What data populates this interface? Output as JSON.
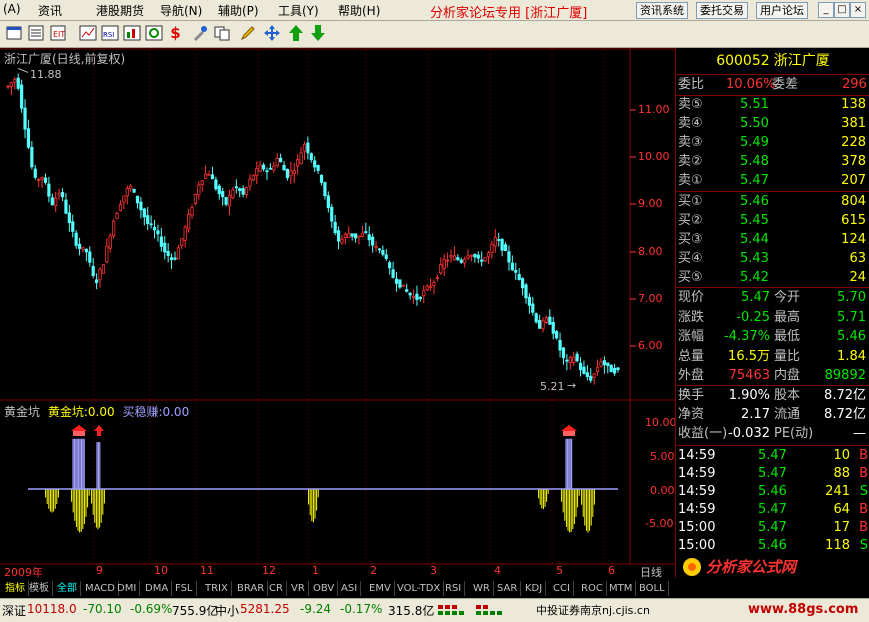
{
  "menubar": {
    "items": [
      "(A)",
      "资讯",
      "港股期货",
      "导航(N)",
      "辅助(P)",
      "工具(Y)",
      "帮助(H)"
    ],
    "notice": "分析家论坛专用 [浙江广厦]",
    "buttons": [
      "资讯系统",
      "委托交易",
      "用户论坛"
    ],
    "window_controls": [
      "_",
      "□",
      "×"
    ]
  },
  "toolbar": {
    "icons": [
      "window-icon",
      "list-icon",
      "edit-icon",
      "line-chart-icon",
      "rsi-icon",
      "chart-grid-icon",
      "refresh-icon",
      "dollar-icon",
      "tool-icon",
      "copy-icon",
      "pencil-icon",
      "move-icon",
      "arrow-up-icon",
      "arrow-down-icon"
    ],
    "labels": [
      "",
      "",
      "",
      "",
      "RSI",
      "",
      "",
      "$",
      "",
      "",
      "",
      "",
      "",
      ""
    ]
  },
  "chart": {
    "title": "浙江广厦(日线,前复权)",
    "high_label": "11.88",
    "low_label": "5.21",
    "price_ticks": [
      "11.00",
      "10.00",
      "9.00",
      "8.00",
      "7.00",
      "6.00"
    ],
    "indicator_title": "黄金坑",
    "indicator_series": [
      {
        "name": "黄金坑:",
        "value": "0.00"
      },
      {
        "name": "买稳赚:",
        "value": "0.00"
      }
    ],
    "indicator_ticks": [
      "10.00",
      "5.00",
      "0.00",
      "-5.00"
    ],
    "x_labels": [
      "2009年",
      "9",
      "10",
      "11",
      "12",
      "1",
      "2",
      "3",
      "4",
      "5",
      "6"
    ],
    "period": "日线"
  },
  "chart_data": [
    {
      "type": "candlestick",
      "title": "浙江广厦(日线,前复权)",
      "ylim": [
        5.0,
        12.0
      ],
      "high": 11.88,
      "low": 5.21,
      "close_path": [
        11.5,
        11.7,
        10.6,
        9.5,
        9.6,
        9.0,
        9.3,
        8.6,
        8.1,
        8.0,
        7.3,
        7.8,
        8.6,
        9.1,
        9.4,
        9.0,
        8.6,
        8.4,
        8.0,
        7.8,
        8.3,
        8.9,
        9.5,
        9.7,
        9.3,
        9.0,
        9.4,
        9.2,
        9.6,
        9.8,
        9.7,
        10.0,
        9.6,
        9.8,
        10.3,
        9.9,
        9.5,
        8.7,
        8.2,
        8.4,
        8.3,
        8.4,
        8.1,
        8.0,
        7.5,
        7.3,
        7.1,
        7.0,
        7.2,
        7.4,
        7.8,
        7.9,
        7.8,
        8.0,
        7.8,
        7.9,
        8.3,
        8.0,
        7.6,
        7.3,
        6.8,
        6.4,
        6.6,
        6.1,
        5.6,
        5.8,
        5.4,
        5.3,
        5.7,
        5.5,
        5.47
      ]
    },
    {
      "type": "bar",
      "title": "黄金坑",
      "series": [
        {
          "name": "黄金坑:",
          "values": [
            -3.5,
            -6.5,
            7.5,
            -6,
            0,
            0,
            0,
            0,
            0,
            0,
            0,
            -5,
            0,
            0,
            0,
            0,
            0,
            0,
            0,
            -3,
            -6.5,
            7.5,
            -6.5,
            -5
          ]
        },
        {
          "name": "买稳赚:",
          "values": [
            0,
            0,
            7.5,
            0,
            0,
            0,
            0,
            0,
            0,
            0,
            0,
            0,
            0,
            0,
            0,
            0,
            0,
            0,
            0,
            0,
            0,
            7.5,
            0,
            0
          ]
        }
      ],
      "ylim": [
        -7.0,
        12.0
      ]
    }
  ],
  "quote": {
    "code": "600052",
    "name": "浙江广厦",
    "wb_label": "委比",
    "wb_value": "10.06%",
    "wc_label": "委差",
    "wc_value": "296",
    "sells": [
      {
        "label": "卖⑤",
        "price": "5.51",
        "vol": "138"
      },
      {
        "label": "卖④",
        "price": "5.50",
        "vol": "381"
      },
      {
        "label": "卖③",
        "price": "5.49",
        "vol": "228"
      },
      {
        "label": "卖②",
        "price": "5.48",
        "vol": "378"
      },
      {
        "label": "卖①",
        "price": "5.47",
        "vol": "207"
      }
    ],
    "buys": [
      {
        "label": "买①",
        "price": "5.46",
        "vol": "804"
      },
      {
        "label": "买②",
        "price": "5.45",
        "vol": "615"
      },
      {
        "label": "买③",
        "price": "5.44",
        "vol": "124"
      },
      {
        "label": "买④",
        "price": "5.43",
        "vol": "63"
      },
      {
        "label": "买⑤",
        "price": "5.42",
        "vol": "24"
      }
    ],
    "stats": [
      {
        "l1": "现价",
        "v1": "5.47",
        "l2": "今开",
        "v2": "5.70"
      },
      {
        "l1": "涨跌",
        "v1": "-0.25",
        "l2": "最高",
        "v2": "5.71"
      },
      {
        "l1": "涨幅",
        "v1": "-4.37%",
        "l2": "最低",
        "v2": "5.46"
      },
      {
        "l1": "总量",
        "v1": "16.5万",
        "l2": "量比",
        "v2": "1.84"
      },
      {
        "l1": "外盘",
        "v1": "75463",
        "l2": "内盘",
        "v2": "89892"
      }
    ],
    "fund": [
      {
        "l1": "换手",
        "v1": "1.90%",
        "l2": "股本",
        "v2": "8.72亿"
      },
      {
        "l1": "净资",
        "v1": "2.17",
        "l2": "流通",
        "v2": "8.72亿"
      },
      {
        "l1": "收益(一)",
        "v1": "-0.032",
        "l2": "PE(动)",
        "v2": "—"
      }
    ],
    "ticks": [
      {
        "time": "14:59",
        "price": "5.47",
        "vol": "10",
        "side": "B"
      },
      {
        "time": "14:59",
        "price": "5.47",
        "vol": "88",
        "side": "B"
      },
      {
        "time": "14:59",
        "price": "5.46",
        "vol": "241",
        "side": "S"
      },
      {
        "time": "14:59",
        "price": "5.47",
        "vol": "64",
        "side": "B"
      },
      {
        "time": "15:00",
        "price": "5.47",
        "vol": "17",
        "side": "B"
      },
      {
        "time": "15:00",
        "price": "5.46",
        "vol": "118",
        "side": "S"
      }
    ],
    "logo_text": "分析家公式网",
    "logo_url": "www.88gs.com"
  },
  "tabs": [
    "指标",
    "模板",
    "全部",
    "MACD",
    "DMI",
    "DMA",
    "FSL",
    "TRIX",
    "BRAR",
    "CR",
    "VR",
    "OBV",
    "ASI",
    "EMV",
    "VOL-TDX",
    "RSI",
    "WR",
    "SAR",
    "KDJ",
    "CCI",
    "ROC",
    "MTM",
    "BOLL"
  ],
  "status": {
    "sz_label": "深证",
    "sz_value": "10118.0",
    "sz_change": "-70.10",
    "sz_pct": "-0.69%",
    "sz_amount": "755.9亿",
    "zx_label": "中小",
    "zx_value": "5281.25",
    "zx_change": "-9.24",
    "zx_pct": "-0.17%",
    "zx_amount": "315.8亿",
    "broker": "中投证券南京nj.cjis.cn"
  }
}
